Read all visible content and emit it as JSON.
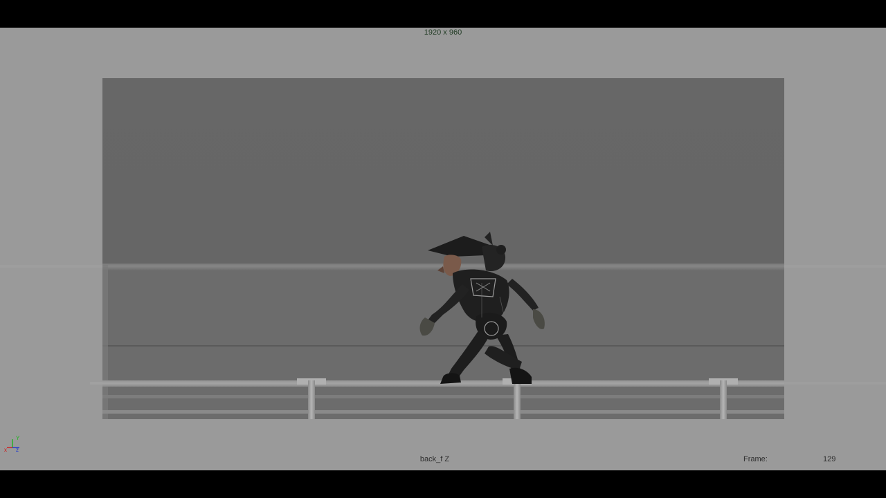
{
  "viewport": {
    "resolution_label": "1920 x 960",
    "camera_name": "back_f Z",
    "frame_label": "Frame:",
    "frame_value": "129",
    "axis": {
      "x": "x",
      "y": "Y",
      "z": "z"
    },
    "colors": {
      "background": "#9a9a9a",
      "gate": "#676767",
      "axis_x": "#d11a1a",
      "axis_y": "#1fb51f",
      "axis_z": "#1a35d1"
    }
  },
  "scene": {
    "character": "armored-ninja-character"
  }
}
